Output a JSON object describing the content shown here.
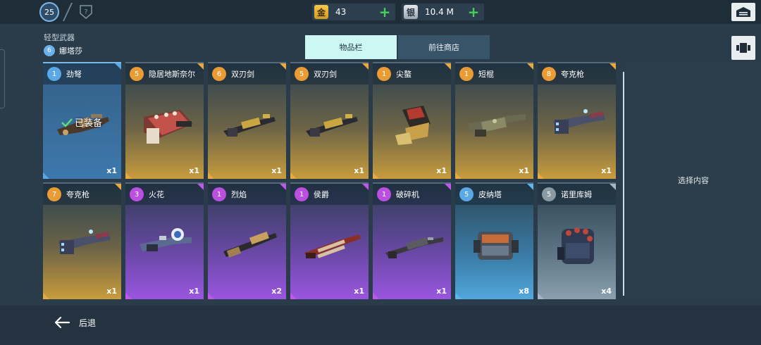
{
  "topbar": {
    "level": "25",
    "gold": {
      "icon_text": "金",
      "value": "43"
    },
    "silver": {
      "icon_text": "银",
      "value": "10.4 M"
    }
  },
  "header": {
    "category": "轻型武器",
    "pilot_level": "6",
    "pilot_name": "娜塔莎"
  },
  "tabs": [
    {
      "label": "物品栏",
      "active": true
    },
    {
      "label": "前往商店",
      "active": false
    }
  ],
  "equipped_label": "已装备",
  "detail_placeholder": "选择内容",
  "footer": {
    "back_label": "后退"
  },
  "items": [
    {
      "level": "1",
      "name": "劲弩",
      "qty": "x1",
      "rarity": "blue",
      "badge": "blue",
      "equipped": true,
      "icon": "crossbow-weapon-icon"
    },
    {
      "level": "5",
      "name": "隐居地斯奈尔",
      "qty": "x1",
      "rarity": "gold",
      "badge": "orange",
      "equipped": false,
      "icon": "rocket-pod-weapon-icon"
    },
    {
      "level": "6",
      "name": "双刃剑",
      "qty": "x1",
      "rarity": "gold",
      "badge": "orange",
      "equipped": false,
      "icon": "rifle-weapon-icon"
    },
    {
      "level": "5",
      "name": "双刃剑",
      "qty": "x1",
      "rarity": "gold",
      "badge": "orange",
      "equipped": false,
      "icon": "rifle-weapon-icon"
    },
    {
      "level": "1",
      "name": "尖螯",
      "qty": "x1",
      "rarity": "gold",
      "badge": "orange",
      "equipped": false,
      "icon": "spike-launcher-weapon-icon"
    },
    {
      "level": "1",
      "name": "短棍",
      "qty": "x1",
      "rarity": "gold",
      "badge": "orange",
      "equipped": false,
      "icon": "cannon-weapon-icon"
    },
    {
      "level": "8",
      "name": "夸克枪",
      "qty": "x1",
      "rarity": "gold",
      "badge": "orange",
      "equipped": false,
      "icon": "energy-gun-weapon-icon"
    },
    {
      "level": "7",
      "name": "夸克枪",
      "qty": "x1",
      "rarity": "gold",
      "badge": "orange",
      "equipped": false,
      "icon": "energy-gun-weapon-icon"
    },
    {
      "level": "3",
      "name": "火花",
      "qty": "x1",
      "rarity": "purple",
      "badge": "purple",
      "equipped": false,
      "icon": "tesla-gun-weapon-icon"
    },
    {
      "level": "1",
      "name": "烈焰",
      "qty": "x2",
      "rarity": "purple",
      "badge": "purple",
      "equipped": false,
      "icon": "flamethrower-weapon-icon"
    },
    {
      "level": "1",
      "name": "侯爵",
      "qty": "x1",
      "rarity": "purple",
      "badge": "purple",
      "equipped": false,
      "icon": "shotgun-weapon-icon"
    },
    {
      "level": "1",
      "name": "破碎机",
      "qty": "x1",
      "rarity": "purple",
      "badge": "purple",
      "equipped": false,
      "icon": "long-rifle-weapon-icon"
    },
    {
      "level": "5",
      "name": "皮纳塔",
      "qty": "x8",
      "rarity": "cyan",
      "badge": "blue",
      "equipped": false,
      "icon": "heavy-launcher-weapon-icon"
    },
    {
      "level": "5",
      "name": "诺里库姆",
      "qty": "x4",
      "rarity": "grey",
      "badge": "grey",
      "equipped": false,
      "icon": "missile-pod-weapon-icon"
    }
  ],
  "colors": {
    "background": "#2a3b4a",
    "tab_active": "#cdf7f3",
    "tab_inactive": "#375468",
    "plus_green": "#44d05a"
  }
}
